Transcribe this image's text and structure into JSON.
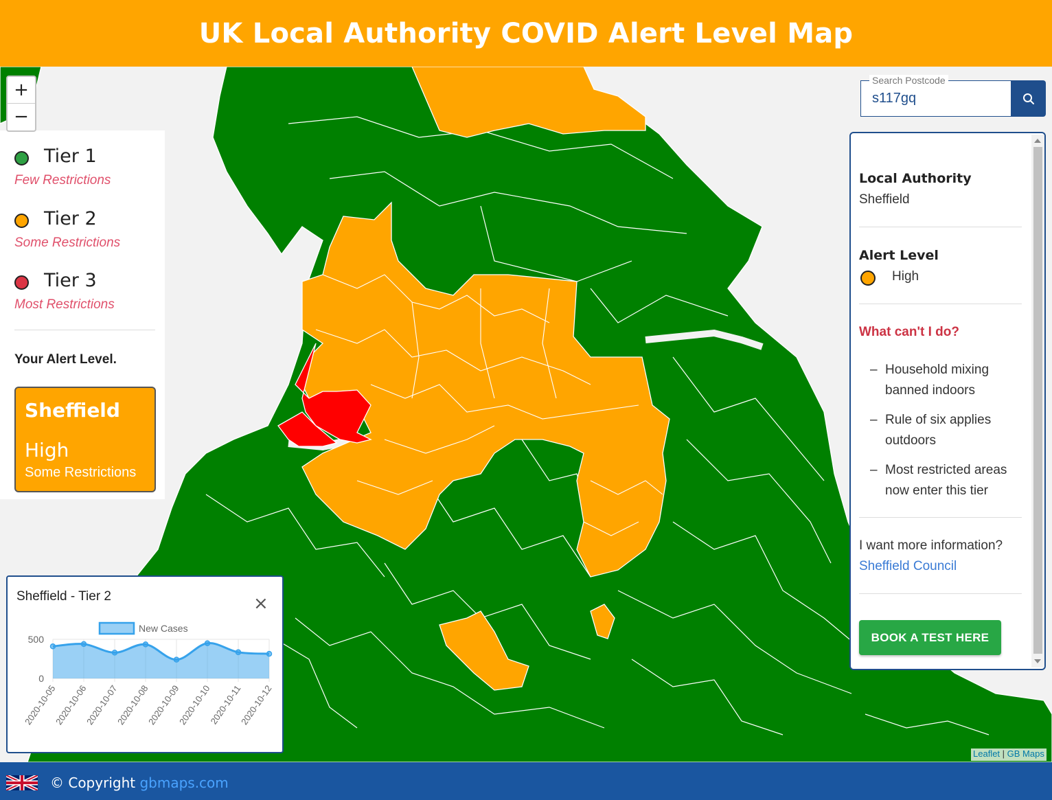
{
  "header": {
    "title": "UK Local Authority COVID Alert Level Map"
  },
  "colors": {
    "tier1": "#007a00",
    "tier2": "#ffa500",
    "tier3": "#ff0000",
    "brand_orange": "#ffa500",
    "brand_blue": "#1f4e8c",
    "footer_blue": "#1a56a0",
    "button_green": "#28a745"
  },
  "zoom": {
    "in": "+",
    "out": "−"
  },
  "legend": {
    "tiers": [
      {
        "name": "Tier 1",
        "desc": "Few Restrictions",
        "color": "#2ea043"
      },
      {
        "name": "Tier 2",
        "desc": "Some Restrictions",
        "color": "#ffa500"
      },
      {
        "name": "Tier 3",
        "desc": "Most Restrictions",
        "color": "#dc3545"
      }
    ],
    "your_level_label": "Your Alert Level.",
    "card": {
      "authority": "Sheffield",
      "level": "High",
      "restrictions": "Some Restrictions"
    }
  },
  "chart_popup": {
    "title": "Sheffield - Tier 2",
    "close_icon": "×"
  },
  "chart_data": {
    "type": "area",
    "title": "",
    "legend": "New Cases",
    "legend_position": "top",
    "x": [
      "2020-10-05",
      "2020-10-06",
      "2020-10-07",
      "2020-10-08",
      "2020-10-09",
      "2020-10-10",
      "2020-10-11",
      "2020-10-12"
    ],
    "series": [
      {
        "name": "New Cases",
        "values": [
          410,
          440,
          330,
          435,
          240,
          450,
          335,
          315
        ]
      }
    ],
    "yticks": [
      0,
      500
    ],
    "ylim": [
      0,
      500
    ],
    "grid": true,
    "color": "#36a2eb"
  },
  "search": {
    "label": "Search Postcode",
    "value": "s117gq",
    "icon": "search-icon"
  },
  "info": {
    "la_label": "Local Authority",
    "la_value": "Sheffield",
    "alert_label": "Alert Level",
    "alert_value": "High",
    "cant_label": "What can't I do?",
    "items": [
      "Household mixing banned indoors",
      "Rule of six applies outdoors",
      "Most restricted areas now enter this tier"
    ],
    "more_label": "I want more information?",
    "more_link": "Sheffield Council",
    "book_button": "BOOK A TEST HERE"
  },
  "attribution": {
    "leaflet": "Leaflet",
    "sep": " | ",
    "gbmaps": "GB Maps"
  },
  "footer": {
    "copyright": "© Copyright ",
    "link": "gbmaps.com"
  }
}
